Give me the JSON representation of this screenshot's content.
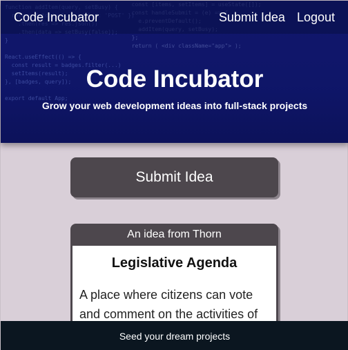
{
  "navbar": {
    "brand": "Code Incubator",
    "links": [
      "Submit Idea",
      "Logout"
    ]
  },
  "hero": {
    "title": "Code Incubator",
    "subtitle": "Grow your web development ideas into full-stack projects"
  },
  "main": {
    "submit_label": "Submit Idea",
    "idea_card": {
      "header": "An idea from Thorn",
      "title": "Legislative Agenda",
      "description": "A place where citizens can vote and comment on the activities of"
    }
  },
  "footer": {
    "text": "Seed your dream projects"
  },
  "colors": {
    "hero_bg": "#12186e",
    "button_bg": "#4d474d",
    "page_bg": "#d9cfd8",
    "footer_bg": "#0b1620"
  }
}
